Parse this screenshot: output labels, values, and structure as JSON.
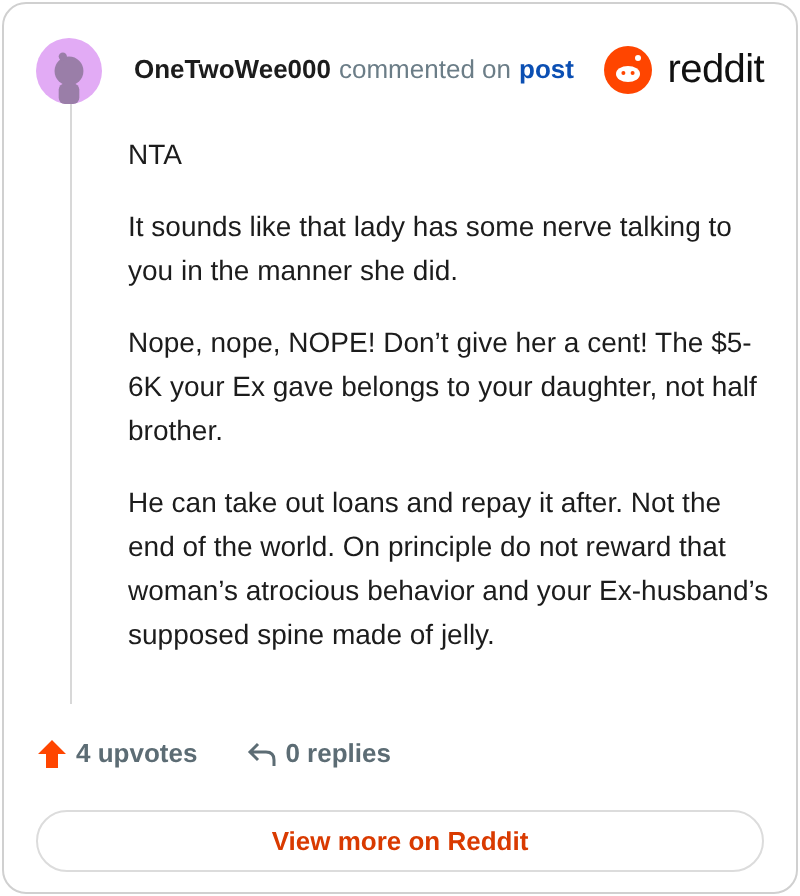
{
  "header": {
    "author": "OneTwoWee000",
    "action": "commented on",
    "link": "post",
    "brand": "reddit"
  },
  "comment": {
    "paragraphs": [
      "NTA",
      "It sounds like that lady has some nerve talking to you in the manner she did.",
      "Nope, nope, NOPE! Don’t give her a cent! The $5-6K your Ex gave belongs to your daughter, not half brother.",
      "He can take out loans and repay it after. Not the end of the world. On principle do not reward that woman’s atrocious behavior and your Ex-husband’s supposed spine made of jelly."
    ]
  },
  "footer": {
    "upvotes": "4 upvotes",
    "replies": "0 replies",
    "button": "View more on Reddit"
  }
}
